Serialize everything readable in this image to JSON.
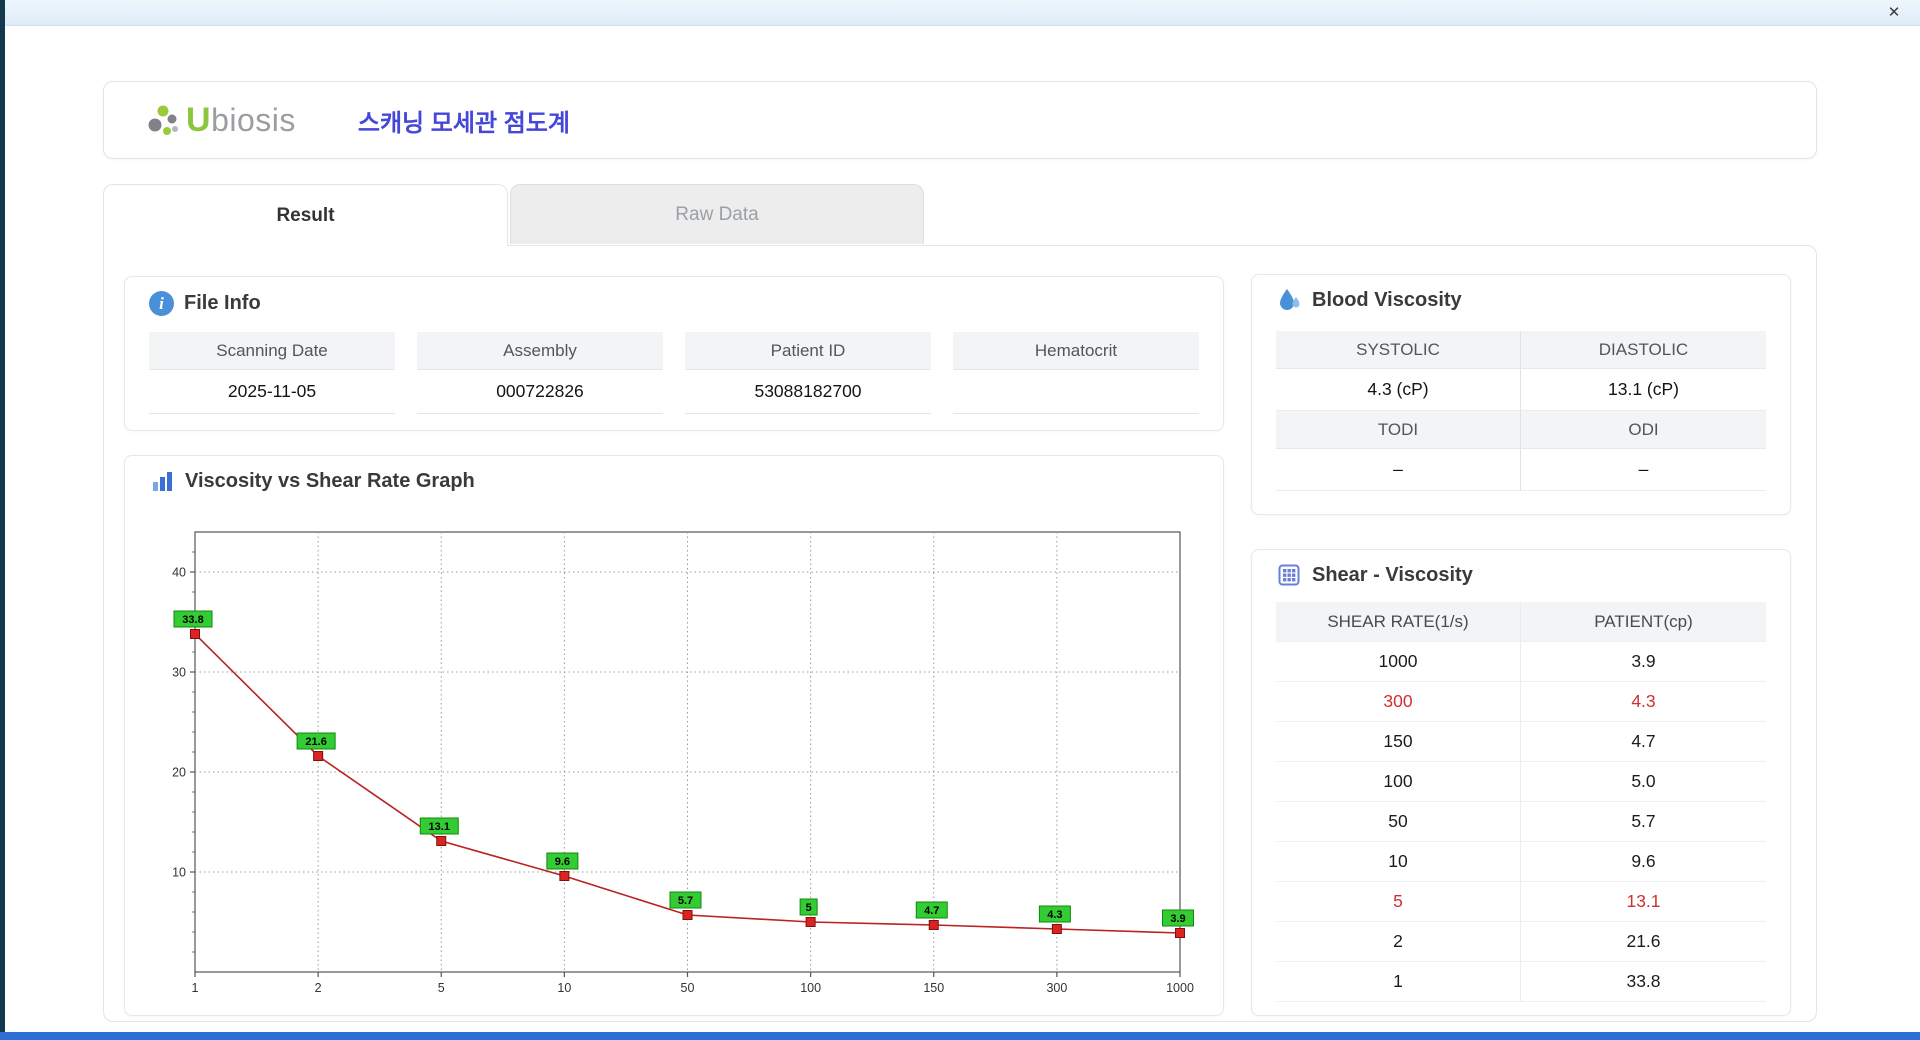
{
  "window": {
    "close_label": "✕"
  },
  "header": {
    "brand_u": "U",
    "brand_rest": "biosis",
    "title": "스캐닝 모세관 점도계"
  },
  "tabs": {
    "result": "Result",
    "raw_data": "Raw Data"
  },
  "file_info": {
    "title": "File Info",
    "fields": [
      {
        "label": "Scanning Date",
        "value": "2025-11-05"
      },
      {
        "label": "Assembly",
        "value": "000722826"
      },
      {
        "label": "Patient ID",
        "value": "53088182700"
      },
      {
        "label": "Hematocrit",
        "value": ""
      }
    ]
  },
  "blood_viscosity": {
    "title": "Blood Viscosity",
    "cells": [
      {
        "label": "SYSTOLIC",
        "value": "4.3 (cP)"
      },
      {
        "label": "DIASTOLIC",
        "value": "13.1 (cP)"
      },
      {
        "label": "TODI",
        "value": "–"
      },
      {
        "label": "ODI",
        "value": "–"
      }
    ]
  },
  "graph": {
    "title": "Viscosity vs Shear Rate Graph"
  },
  "shear_viscosity": {
    "title": "Shear - Viscosity",
    "columns": [
      "SHEAR RATE(1/s)",
      "PATIENT(cp)"
    ],
    "rows": [
      {
        "rate": "1000",
        "value": "3.9",
        "highlight": false
      },
      {
        "rate": "300",
        "value": "4.3",
        "highlight": true
      },
      {
        "rate": "150",
        "value": "4.7",
        "highlight": false
      },
      {
        "rate": "100",
        "value": "5.0",
        "highlight": false
      },
      {
        "rate": "50",
        "value": "5.7",
        "highlight": false
      },
      {
        "rate": "10",
        "value": "9.6",
        "highlight": false
      },
      {
        "rate": "5",
        "value": "13.1",
        "highlight": true
      },
      {
        "rate": "2",
        "value": "21.6",
        "highlight": false
      },
      {
        "rate": "1",
        "value": "33.8",
        "highlight": false
      }
    ]
  },
  "chart_data": {
    "type": "line",
    "title": "Viscosity vs Shear Rate Graph",
    "x_scale": "categorical",
    "x_categories": [
      "1",
      "2",
      "5",
      "10",
      "50",
      "100",
      "150",
      "300",
      "1000"
    ],
    "values": [
      33.8,
      21.6,
      13.1,
      9.6,
      5.7,
      5.0,
      4.7,
      4.3,
      3.9
    ],
    "point_labels": [
      "33.8",
      "21.6",
      "13.1",
      "9.6",
      "5.7",
      "5",
      "4.7",
      "4.3",
      "3.9"
    ],
    "xlabel": "",
    "ylabel": "",
    "ylim": [
      0,
      44
    ],
    "yticks": [
      10,
      20,
      30,
      40
    ],
    "grid": true,
    "legend": "none",
    "line_color": "#bb2222",
    "marker_color": "#dd2222",
    "marker_border": "#7a1010",
    "label_bg": "#33cc33",
    "label_border": "#118811",
    "axis_color": "#555555",
    "grid_color": "#9a9a9a"
  },
  "colors": {
    "accent_blue": "#4a90d9",
    "title_purple": "#4547d9",
    "highlight_red": "#d03030",
    "brand_green": "#8cc63f"
  }
}
